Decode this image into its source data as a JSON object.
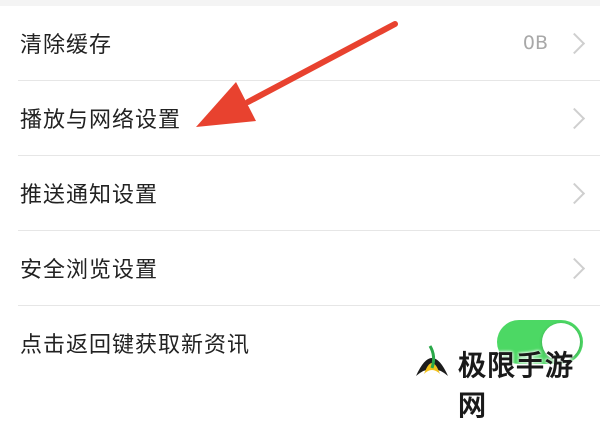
{
  "settings": {
    "items": [
      {
        "label": "清除缓存",
        "value": "0B"
      },
      {
        "label": "播放与网络设置"
      },
      {
        "label": "推送通知设置"
      },
      {
        "label": "安全浏览设置"
      },
      {
        "label": "点击返回键获取新资讯",
        "toggle_on": true
      }
    ]
  },
  "watermark": {
    "text": "极限手游网"
  },
  "colors": {
    "toggle_on": "#4cd864",
    "arrow": "#e8422f",
    "chevron": "#cfcfcf"
  },
  "icons": {
    "chevron": "chevron-right-icon",
    "arrow": "red-arrow-annotation",
    "logo": "watermark-logo-icon"
  }
}
